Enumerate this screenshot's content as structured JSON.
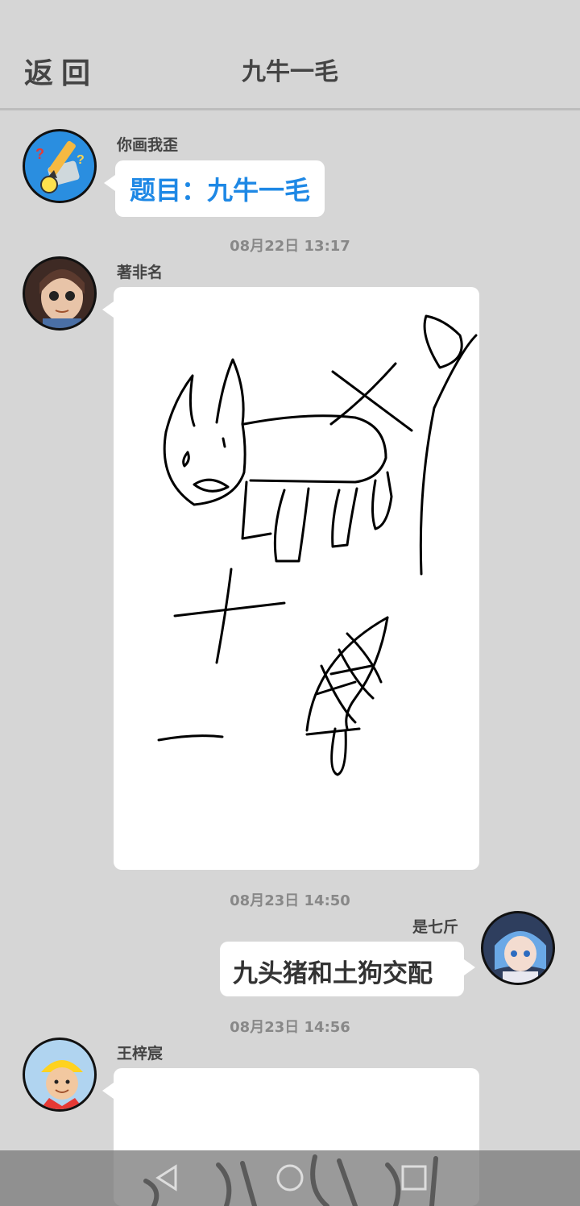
{
  "header": {
    "back_label": "返回",
    "title": "九牛一毛"
  },
  "messages": [
    {
      "sender": "你画我歪",
      "text": "题目：九牛一毛",
      "text_color": "#1e88e5"
    },
    {
      "timestamp": "08月22日  13:17",
      "sender": "著非名"
    },
    {
      "timestamp": "08月23日  14:50",
      "sender": "是七斤",
      "text": "九头猪和土狗交配"
    },
    {
      "timestamp": "08月23日  14:56",
      "sender": "王梓宸"
    }
  ],
  "colors": {
    "background": "#d6d6d6",
    "bubble": "#ffffff",
    "accent": "#1e88e5"
  },
  "icons": [
    "back-triangle-icon",
    "home-circle-icon",
    "recent-square-icon"
  ]
}
